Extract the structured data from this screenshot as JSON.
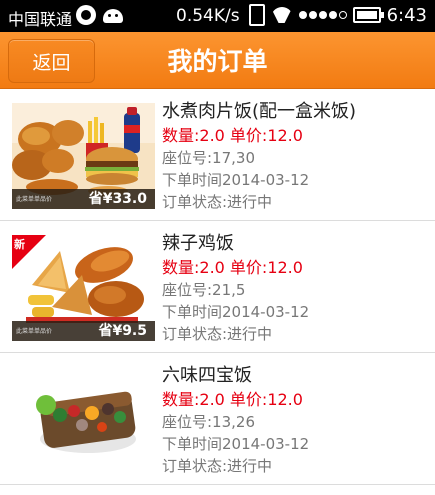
{
  "status_bar": {
    "carrier": "中国联通",
    "speed": "0.54K/s",
    "time": "6:43",
    "icons": [
      "notification-circle-icon",
      "android-icon",
      "vibrate-icon",
      "wifi-icon",
      "signal-dots-icon",
      "battery-icon"
    ]
  },
  "header": {
    "back_label": "返回",
    "title": "我的订单",
    "background": "#f58420"
  },
  "orders": [
    {
      "name": "水煮肉片饭(配一盒米饭)",
      "qty_price": "数量:2.0 单价:12.0",
      "seat": "座位号:17,30",
      "time": "下单时间2014-03-12",
      "status": "订单状态:进行中",
      "price_tag": "省¥33.0",
      "image_caption": "此菜单单品价",
      "new_badge": ""
    },
    {
      "name": "辣子鸡饭",
      "qty_price": "数量:2.0 单价:12.0",
      "seat": "座位号:21,5",
      "time": "下单时间2014-03-12",
      "status": "订单状态:进行中",
      "price_tag": "省¥9.5",
      "image_caption": "此菜单单品价",
      "new_badge": "新"
    },
    {
      "name": "六味四宝饭",
      "qty_price": "数量:2.0 单价:12.0",
      "seat": "座位号:13,26",
      "time": "下单时间2014-03-12",
      "status": "订单状态:进行中",
      "price_tag": "",
      "image_caption": "",
      "new_badge": ""
    }
  ],
  "colors": {
    "accent": "#f58420",
    "qty_red": "#e60012"
  }
}
